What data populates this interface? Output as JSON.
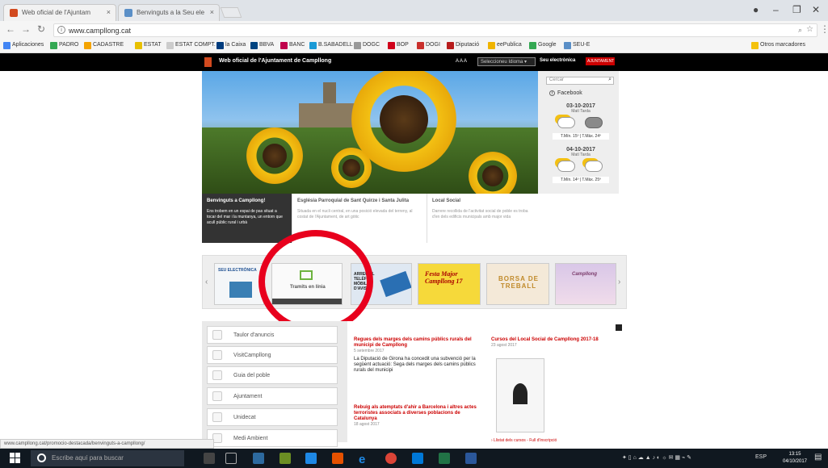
{
  "browser": {
    "tabs": [
      {
        "title": "Web oficial de l'Ajuntam",
        "active": true
      },
      {
        "title": "Benvinguts a la Seu ele",
        "active": false
      }
    ],
    "url": "www.campllong.cat",
    "bookmarks": [
      "Aplicaciones",
      "PADRO",
      "CADASTRE",
      "ESTAT",
      "ESTAT COMPT.",
      "la Caixa",
      "BBVA",
      "BANC",
      "B.SABADELL",
      "DOGC",
      "BOP",
      "DOGI",
      "Diputació",
      "eePublica",
      "Google",
      "SEU-E"
    ],
    "other_bookmarks": "Otros marcadores"
  },
  "site": {
    "header_title": "Web oficial de l'Ajuntament de Campllong",
    "font_size_control": "A A A",
    "select_label": "Seleccioneu Idioma",
    "seu_label": "Seu electrònica",
    "seu_label2": "AJUNTAMENT"
  },
  "sidebar": {
    "search_placeholder": "Cercar",
    "facebook": "Facebook",
    "weather": [
      {
        "date": "03-10-2017",
        "parts": "Matí        Tarda",
        "temps": "T.Mín. 15º | T.Màx. 24º"
      },
      {
        "date": "04-10-2017",
        "parts": "Matí        Tarda",
        "temps": "T.Mín. 14º | T.Màx. 25º"
      }
    ]
  },
  "news_strip": [
    {
      "title": "Benvinguts a Campllong!",
      "body": "Ens trobem en un espai de pas situat a tocar del mar i la muntanya, un entorn que acull públic rural i urbà"
    },
    {
      "title": "Església Parroquial de Sant Quirze i Santa Julita",
      "body": "Situada en el nucli central, en una posició elevada del terreny, al costat de l'Ajuntament, de art gòtic"
    },
    {
      "title": "Local Social",
      "body": "Darrere recollida de l'activitat social de poble es troba d'en dels edificis municipals amb major vida"
    }
  ],
  "banners": [
    {
      "label": "SEU ELECTRÒNICA"
    },
    {
      "label": "Tramits en línia"
    },
    {
      "label": "ARREU EL TELÈFON MÒBIL D'AVISOS"
    },
    {
      "label": "Festa Major Campllong 17"
    },
    {
      "label": "BORSA DE TREBALL"
    },
    {
      "label": "Campllong"
    }
  ],
  "menu": [
    {
      "label": "Taulor d'anuncis"
    },
    {
      "label": "VisitCampllong"
    },
    {
      "label": "Guia del poble"
    },
    {
      "label": "Ajuntament"
    },
    {
      "label": "Unidecat"
    },
    {
      "label": "Medi Ambient"
    }
  ],
  "col2": [
    {
      "title": "Regues dels marges dels camins públics rurals del municipi de Campllong",
      "date": "5 setembre 2017",
      "body": "La Diputació de Girona ha concedit una subvenció per la següent actuació: Sega dels marges dels camins públics rurals del municipi"
    },
    {
      "title": "Rebuig als atemptats d'ahir a Barcelona i altres actes terroristes associats a diverses poblacions de Catalunya",
      "date": "18 agost 2017",
      "body": ""
    }
  ],
  "col3": {
    "title": "Cursos del Local Social de Campllong 2017-18",
    "date": "23 agost 2017",
    "footer": "› Llistat dels cursos - Full d'inscripció"
  },
  "statusbar": "www.campllong.cat/promocio-destacada/benvinguts-a-campllong/",
  "taskbar": {
    "search": "Escribe aquí para buscar",
    "lang": "ESP",
    "time": "13:15",
    "date": "04/10/2017"
  }
}
